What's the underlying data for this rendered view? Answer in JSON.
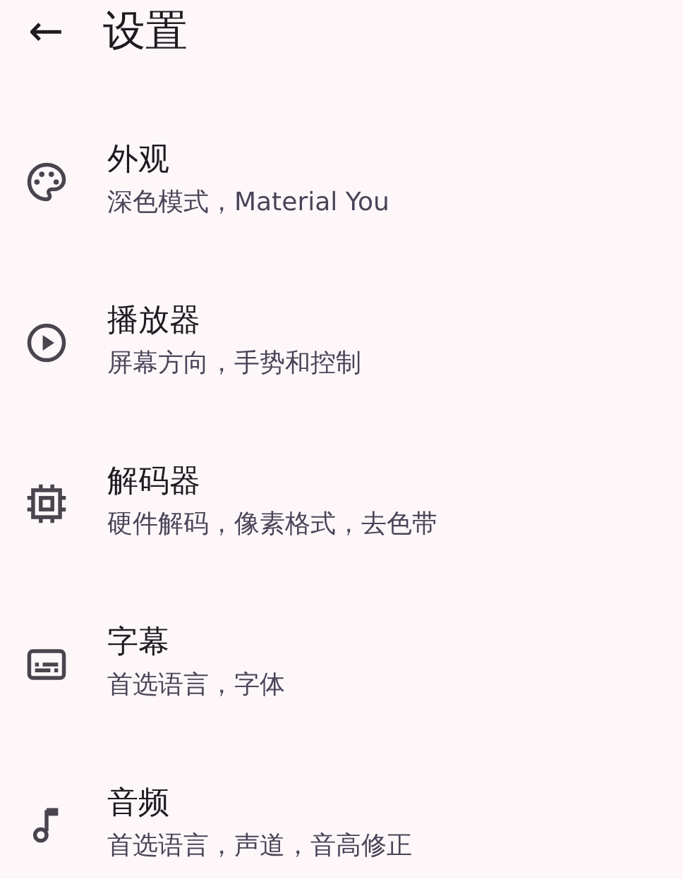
{
  "header": {
    "back_icon": "←",
    "title": "设置"
  },
  "items": [
    {
      "kind": "palette",
      "title": "外观",
      "subtitle": "深色模式，Material You"
    },
    {
      "kind": "play",
      "title": "播放器",
      "subtitle": "屏幕方向，手势和控制"
    },
    {
      "kind": "chip",
      "title": "解码器",
      "subtitle": "硬件解码，像素格式，去色带"
    },
    {
      "kind": "subtitles",
      "title": "字幕",
      "subtitle": "首选语言，字体"
    },
    {
      "kind": "music",
      "title": "音频",
      "subtitle": "首选语言，声道，音高修正"
    }
  ]
}
